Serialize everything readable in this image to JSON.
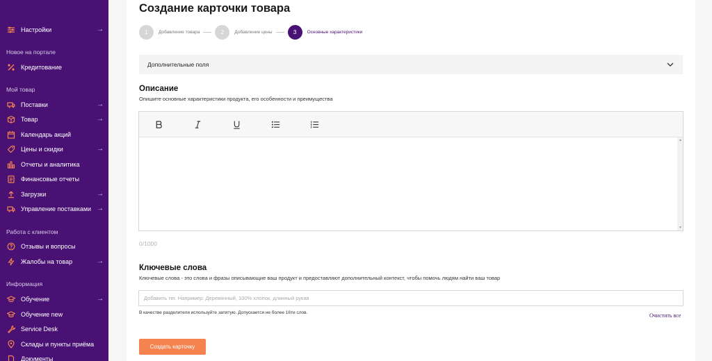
{
  "sidebar": {
    "items": [
      {
        "label": "Настройки",
        "icon": "settings-sliders-icon",
        "arrow": "→"
      },
      {
        "label": "Кредитование",
        "icon": "percent-icon",
        "arrow": ""
      },
      {
        "label": "Поставки",
        "icon": "truck-icon",
        "arrow": "→"
      },
      {
        "label": "Товар",
        "icon": "box-icon",
        "arrow": "→"
      },
      {
        "label": "Календарь акций",
        "icon": "calendar-icon",
        "arrow": ""
      },
      {
        "label": "Цены и скидки",
        "icon": "tag-icon",
        "arrow": "→"
      },
      {
        "label": "Отчеты и аналитика",
        "icon": "bar-chart-icon",
        "arrow": ""
      },
      {
        "label": "Финансовые отчеты",
        "icon": "document-icon",
        "arrow": ""
      },
      {
        "label": "Загрузки",
        "icon": "upload-icon",
        "arrow": "→"
      },
      {
        "label": "Управление поставками",
        "icon": "delivery-icon",
        "arrow": "→"
      },
      {
        "label": "Отзывы и вопросы",
        "icon": "question-icon",
        "arrow": ""
      },
      {
        "label": "Жалобы на товар",
        "icon": "lightning-icon",
        "arrow": "→"
      },
      {
        "label": "Обучение",
        "icon": "graduation-cap-icon",
        "arrow": "→"
      },
      {
        "label": "Обучение new",
        "icon": "graduation-cap-icon",
        "arrow": ""
      },
      {
        "label": "Service Desk",
        "icon": "wrench-icon",
        "arrow": ""
      },
      {
        "label": "Склады и пункты приёма",
        "icon": "map-pin-icon",
        "arrow": ""
      },
      {
        "label": "Документы",
        "icon": "file-icon",
        "arrow": ""
      }
    ],
    "sections": {
      "new_on_portal": "Новое на портале",
      "my_product": "Мой товар",
      "client_work": "Работа с клиентом",
      "information": "Информация"
    }
  },
  "page": {
    "title": "Создание карточки товара",
    "steps": [
      {
        "number": "1",
        "label": "Добавление товара",
        "state": "done"
      },
      {
        "number": "2",
        "label": "Добавление цены",
        "state": "done"
      },
      {
        "number": "3",
        "label": "Основные характеристики",
        "state": "active"
      }
    ],
    "accordion_label": "Дополнительные поля",
    "description": {
      "title": "Описание",
      "subtitle": "Опишите основные характеристики продукта, его особенности и преимущества",
      "counter": "0/1000",
      "toolbar": [
        "bold",
        "italic",
        "underline",
        "bulleted-list",
        "numbered-list"
      ]
    },
    "keywords": {
      "title": "Ключевые слова",
      "subtitle": "Ключевые слова - это слова и фразы описывающие ваш продукт и предоставляют дополнительный контекст, чтобы помочь людям найти ваш товар",
      "placeholder": "Добавить тег. Например: Деревянный, 100% хлопок, длинный рукав",
      "hint": "В качестве разделителя используйте запятую. Допускается не более 16ти слов.",
      "clear_label": "Очистить все"
    },
    "create_button": "Создать карточку"
  },
  "colors": {
    "sidebar_bg": "#481173",
    "accent": "#481173",
    "button": "#f48350"
  }
}
